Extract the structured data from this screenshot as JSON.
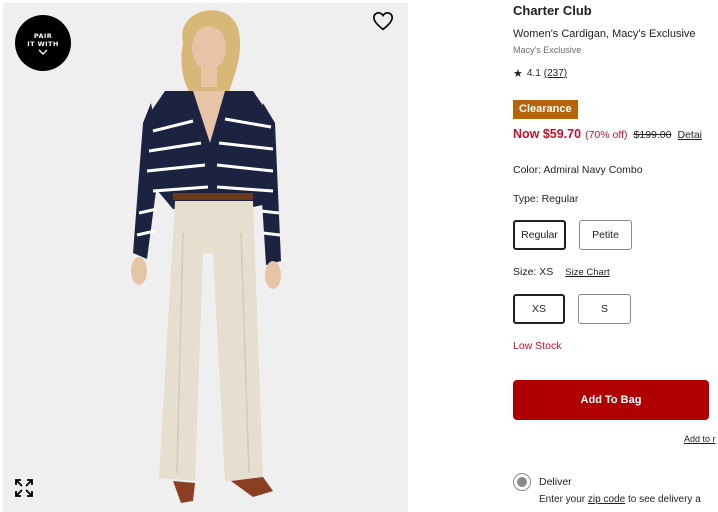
{
  "image_panel": {
    "badge": {
      "line1": "PAIR",
      "line2": "IT WITH",
      "icon": "chevron-down-icon"
    },
    "wishlist_icon": "heart-icon",
    "expand_icon": "expand-icon"
  },
  "product": {
    "brand": "Charter Club",
    "name": "Women's Cardigan, Macy's Exclusive",
    "exclusive": "Macy's Exclusive",
    "rating": {
      "star_icon": "star-icon",
      "value": "4.1",
      "count": "(237)"
    },
    "badge": "Clearance",
    "price": {
      "now": "Now $59.70",
      "discount": "(70% off)",
      "original": "$199.00",
      "details_link": "Detai"
    },
    "color_label": "Color: Admiral Navy Combo",
    "type_label": "Type: Regular",
    "type_options": [
      "Regular",
      "Petite"
    ],
    "size_label": "Size: XS",
    "size_chart_link": "Size Chart",
    "size_options": [
      "XS",
      "S"
    ],
    "stock_status": "Low Stock",
    "add_to_bag": "Add To Bag",
    "add_to_registry": "Add to r",
    "delivery": {
      "label": "Deliver",
      "prefix": "Enter your",
      "zip_link": "zip code",
      "suffix": "to see delivery a"
    }
  },
  "colors": {
    "accent_red": "#c8102e",
    "button_red": "#b00000",
    "clearance_orange": "#b7630c"
  }
}
